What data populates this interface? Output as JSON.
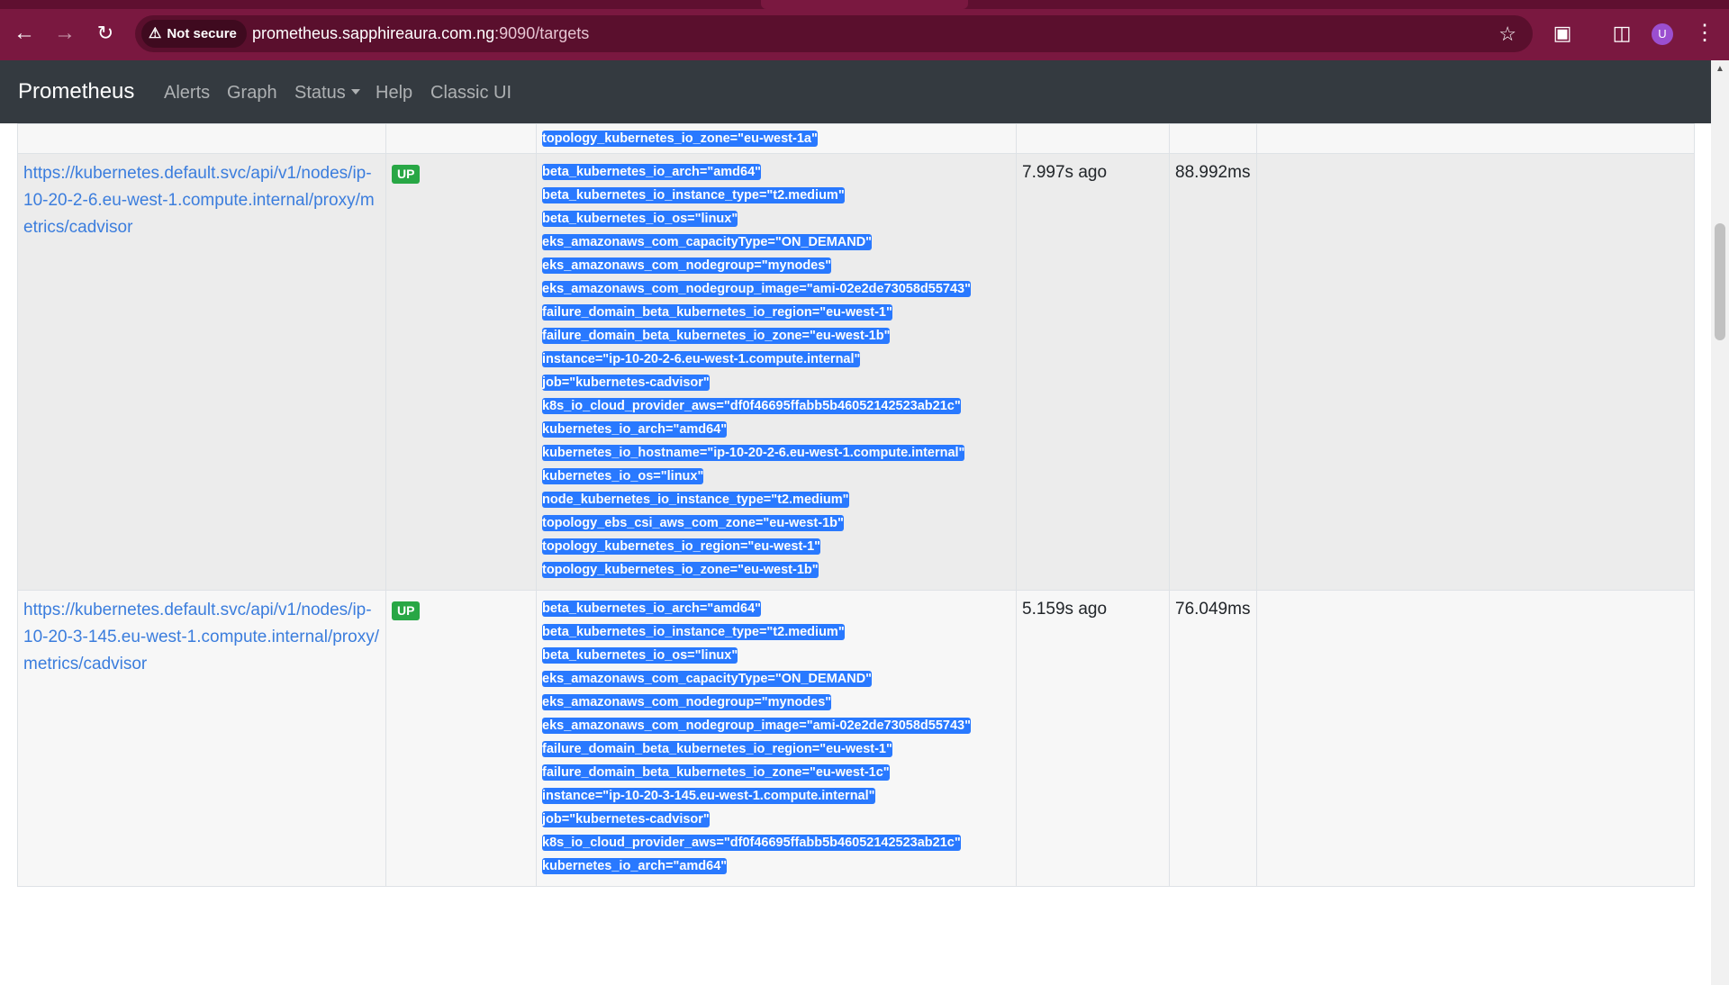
{
  "browser": {
    "security_label": "Not secure",
    "url_host": "prometheus.sapphireaura.com.ng",
    "url_rest": ":9090/targets",
    "profile_initial": "U"
  },
  "navbar": {
    "brand": "Prometheus",
    "links": [
      "Alerts",
      "Graph",
      "Status",
      "Help",
      "Classic UI"
    ]
  },
  "colors": {
    "chrome": "#7a1840",
    "navbar": "#343a40",
    "label": "#2979ff",
    "up_badge": "#28a745",
    "link": "#3b7ddd"
  },
  "targets": {
    "partial_row": {
      "labels": [
        "topology_kubernetes_io_zone=\"eu-west-1a\""
      ]
    },
    "rows": [
      {
        "endpoint": "https://kubernetes.default.svc/api/v1/nodes/ip-10-20-2-6.eu-west-1.compute.internal/proxy/metrics/cadvisor",
        "state": "UP",
        "last_scrape": "7.997s ago",
        "duration": "88.992ms",
        "labels": [
          "beta_kubernetes_io_arch=\"amd64\"",
          "beta_kubernetes_io_instance_type=\"t2.medium\"",
          "beta_kubernetes_io_os=\"linux\"",
          "eks_amazonaws_com_capacityType=\"ON_DEMAND\"",
          "eks_amazonaws_com_nodegroup=\"mynodes\"",
          "eks_amazonaws_com_nodegroup_image=\"ami-02e2de73058d55743\"",
          "failure_domain_beta_kubernetes_io_region=\"eu-west-1\"",
          "failure_domain_beta_kubernetes_io_zone=\"eu-west-1b\"",
          "instance=\"ip-10-20-2-6.eu-west-1.compute.internal\"",
          "job=\"kubernetes-cadvisor\"",
          "k8s_io_cloud_provider_aws=\"df0f46695ffabb5b46052142523ab21c\"",
          "kubernetes_io_arch=\"amd64\"",
          "kubernetes_io_hostname=\"ip-10-20-2-6.eu-west-1.compute.internal\"",
          "kubernetes_io_os=\"linux\"",
          "node_kubernetes_io_instance_type=\"t2.medium\"",
          "topology_ebs_csi_aws_com_zone=\"eu-west-1b\"",
          "topology_kubernetes_io_region=\"eu-west-1\"",
          "topology_kubernetes_io_zone=\"eu-west-1b\""
        ]
      },
      {
        "endpoint": "https://kubernetes.default.svc/api/v1/nodes/ip-10-20-3-145.eu-west-1.compute.internal/proxy/metrics/cadvisor",
        "state": "UP",
        "last_scrape": "5.159s ago",
        "duration": "76.049ms",
        "labels": [
          "beta_kubernetes_io_arch=\"amd64\"",
          "beta_kubernetes_io_instance_type=\"t2.medium\"",
          "beta_kubernetes_io_os=\"linux\"",
          "eks_amazonaws_com_capacityType=\"ON_DEMAND\"",
          "eks_amazonaws_com_nodegroup=\"mynodes\"",
          "eks_amazonaws_com_nodegroup_image=\"ami-02e2de73058d55743\"",
          "failure_domain_beta_kubernetes_io_region=\"eu-west-1\"",
          "failure_domain_beta_kubernetes_io_zone=\"eu-west-1c\"",
          "instance=\"ip-10-20-3-145.eu-west-1.compute.internal\"",
          "job=\"kubernetes-cadvisor\"",
          "k8s_io_cloud_provider_aws=\"df0f46695ffabb5b46052142523ab21c\"",
          "kubernetes_io_arch=\"amd64\""
        ]
      }
    ]
  }
}
